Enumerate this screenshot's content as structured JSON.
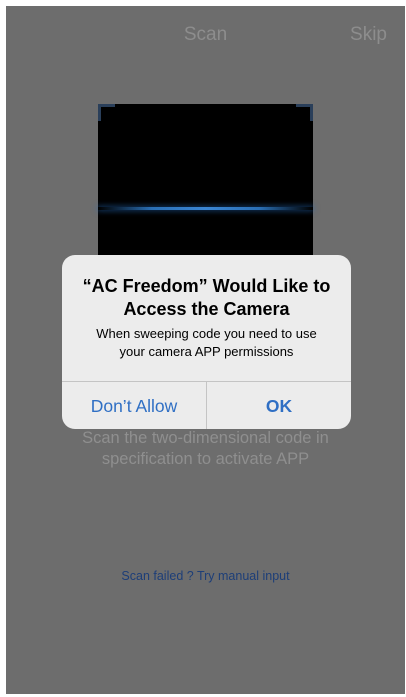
{
  "header": {
    "title": "Scan",
    "skip_label": "Skip"
  },
  "instructions": {
    "line1": "Scan the two-dimensional code in",
    "line2": "specification to activate APP"
  },
  "manual_input_link": "Scan failed ? Try manual input",
  "alert": {
    "title_line1": "“AC Freedom” Would Like to",
    "title_line2": "Access the Camera",
    "message_line1": "When sweeping code you need to use",
    "message_line2": "your camera APP permissions",
    "deny_label": "Don’t Allow",
    "ok_label": "OK"
  },
  "colors": {
    "overlay_background": "#6d6d6d",
    "alert_background": "#ececec",
    "alert_button_text": "#2f6fc4",
    "scan_line": "#3b86d4",
    "manual_link": "#1d3e78"
  }
}
